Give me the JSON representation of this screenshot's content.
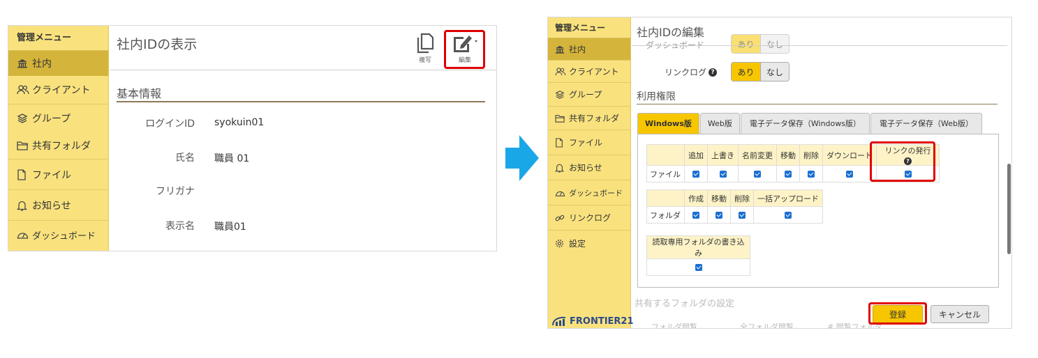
{
  "left": {
    "menu_title": "管理メニュー",
    "sidebar": [
      {
        "label": "社内",
        "icon": "building-icon",
        "active": true
      },
      {
        "label": "クライアント",
        "icon": "users-icon"
      },
      {
        "label": "グループ",
        "icon": "layers-icon"
      },
      {
        "label": "共有フォルダ",
        "icon": "folder-icon"
      },
      {
        "label": "ファイル",
        "icon": "file-icon"
      },
      {
        "label": "お知らせ",
        "icon": "bell-icon"
      },
      {
        "label": "ダッシュボード",
        "icon": "dashboard-icon"
      }
    ],
    "page_title": "社内IDの表示",
    "toolbar": {
      "copy_label": "複写",
      "edit_label": "編集"
    },
    "section_title": "基本情報",
    "fields": [
      {
        "label": "ログインID",
        "value": "syokuin01"
      },
      {
        "label": "氏名",
        "value": "職員 01"
      },
      {
        "label": "フリガナ",
        "value": ""
      },
      {
        "label": "表示名",
        "value": "職員01"
      }
    ]
  },
  "right": {
    "menu_title": "管理メニュー",
    "sidebar": [
      {
        "label": "社内",
        "icon": "building-icon",
        "active": true
      },
      {
        "label": "クライアント",
        "icon": "users-icon"
      },
      {
        "label": "グループ",
        "icon": "layers-icon"
      },
      {
        "label": "共有フォルダ",
        "icon": "folder-icon"
      },
      {
        "label": "ファイル",
        "icon": "file-icon"
      },
      {
        "label": "お知らせ",
        "icon": "bell-icon"
      },
      {
        "label": "ダッシュボード",
        "icon": "dashboard-icon"
      },
      {
        "label": "リンクログ",
        "icon": "link-icon"
      },
      {
        "label": "設定",
        "icon": "gear-icon"
      }
    ],
    "logo_text": "FRONTIER21",
    "page_title": "社内IDの編集",
    "ghost_row_label": "ダッシュボード",
    "toggle_on_label": "あり",
    "toggle_off_label": "なし",
    "linklog_label": "リンクログ",
    "section_title": "利用権限",
    "tabs": [
      "Windows版",
      "Web版",
      "電子データ保存（Windows版）",
      "電子データ保存（Web版）"
    ],
    "file_table": {
      "row_label": "ファイル",
      "columns": [
        "追加",
        "上書き",
        "名前変更",
        "移動",
        "削除",
        "ダウンロード",
        "リンクの発行"
      ]
    },
    "folder_table": {
      "row_label": "フォルダ",
      "columns": [
        "作成",
        "移動",
        "削除",
        "一括アップロード"
      ]
    },
    "readonly_table": {
      "columns": [
        "読取専用フォルダの書き込み"
      ]
    },
    "ghost_section": "共有するフォルダの設定",
    "ghost_footer": [
      "フォルダ閲覧",
      "全フォルダ閲覧",
      "# 閲覧フォルダ"
    ],
    "buttons": {
      "register": "登録",
      "cancel": "キャンセル"
    },
    "colors": {
      "accent": "#f7c600",
      "sidebar": "#f9e27e",
      "highlight": "#e00000",
      "arrow": "#1aa7e8"
    }
  }
}
